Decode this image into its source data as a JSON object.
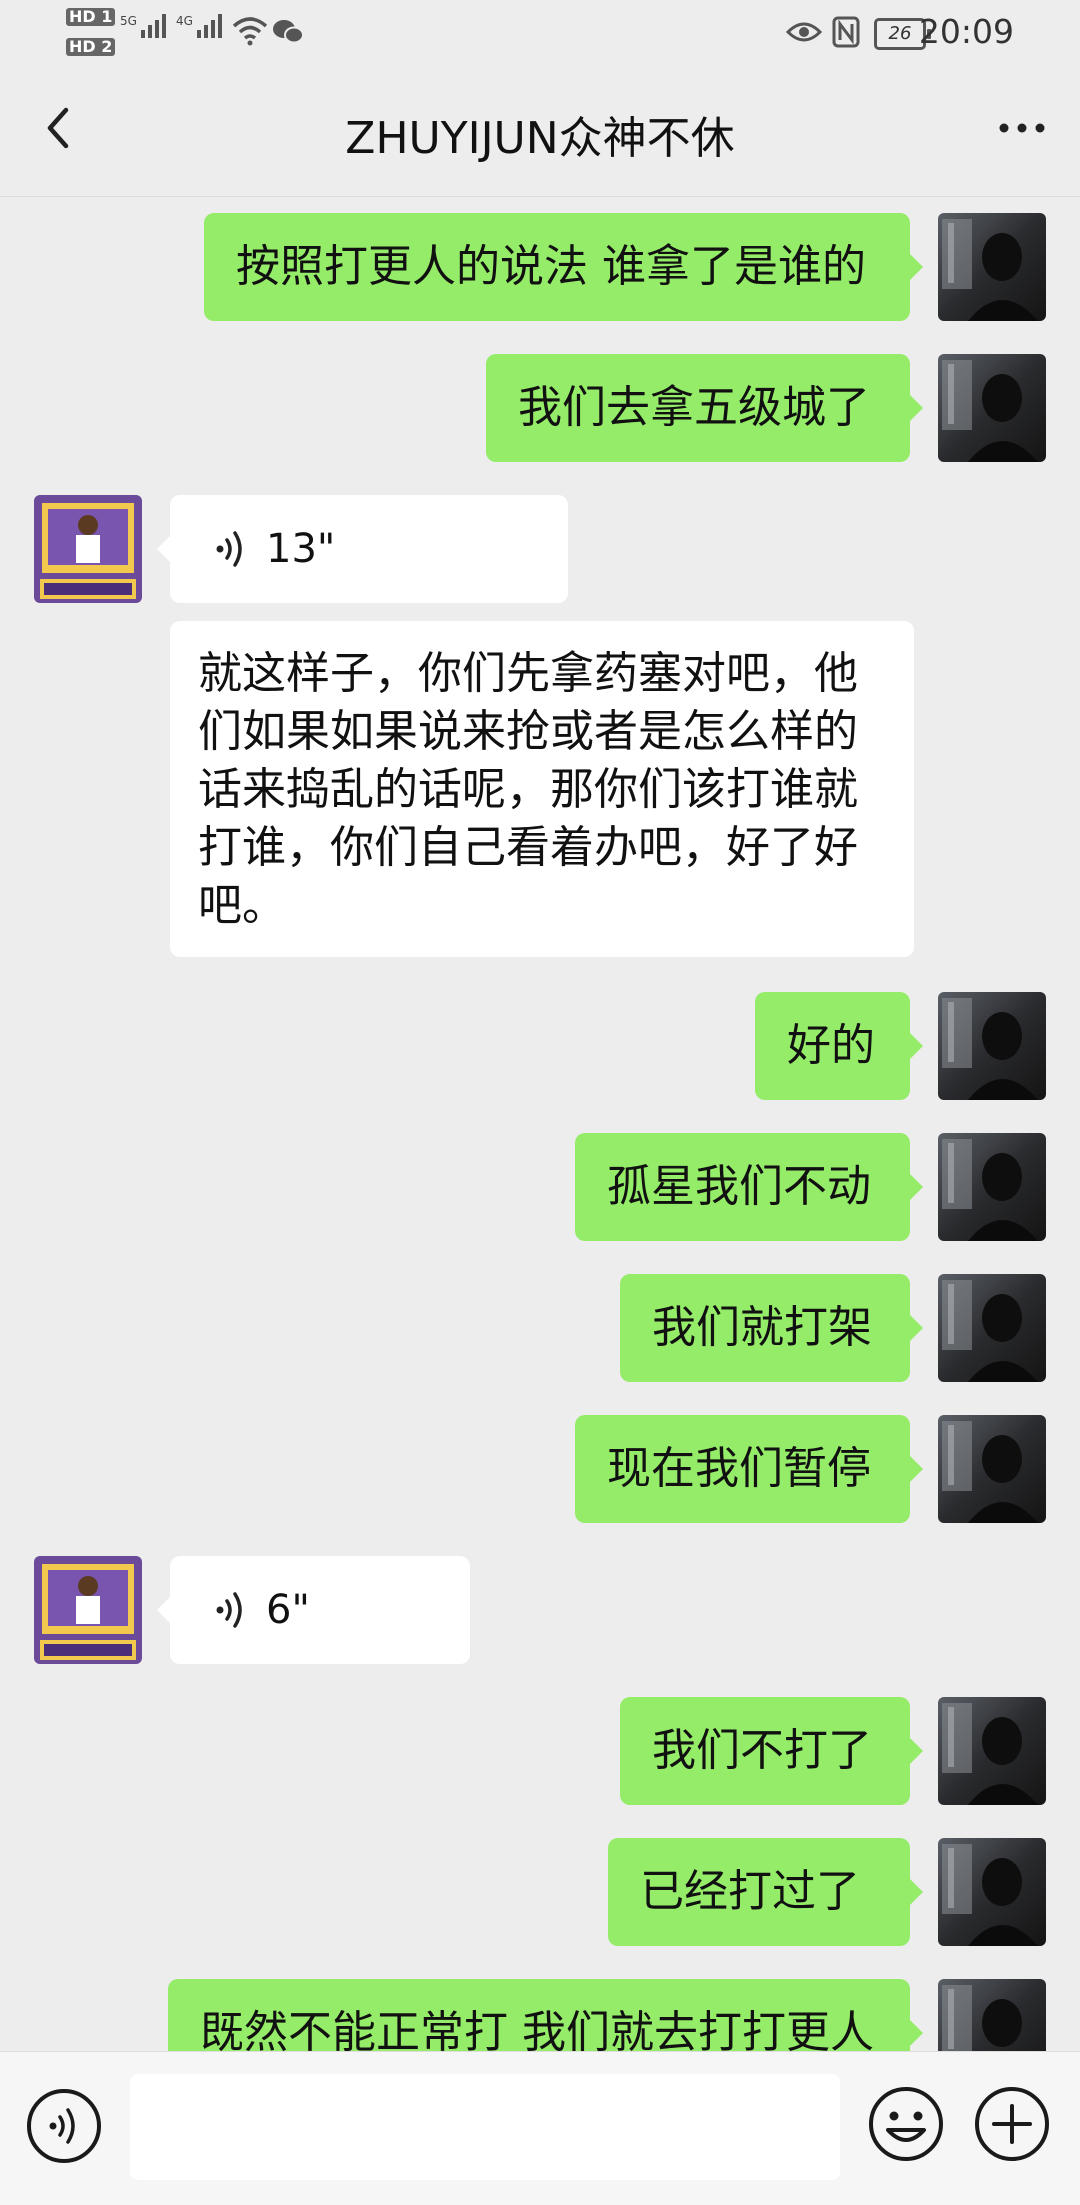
{
  "status_bar": {
    "hd1": "HD 1",
    "hd2": "HD 2",
    "net1": "5G",
    "net2": "4G",
    "battery": "26",
    "time": "20:09",
    "icons": [
      "signal-icon",
      "wifi-icon",
      "wechat-icon",
      "eye-icon",
      "nfc-icon",
      "battery-icon"
    ]
  },
  "nav": {
    "title": "ZHUYIJUN众神不休",
    "back_icon": "chevron-left-icon",
    "more_icon": "more-dots-icon"
  },
  "colors": {
    "background": "#ededed",
    "sent_bubble": "#95ec69",
    "received_bubble": "#ffffff",
    "input_bar": "#f6f6f6"
  },
  "messages": [
    {
      "sender": "me",
      "type": "text",
      "text": "按照打更人的说法 谁拿了是谁的"
    },
    {
      "sender": "me",
      "type": "text",
      "text": "我们去拿五级城了"
    },
    {
      "sender": "other",
      "type": "voice",
      "duration": "13\""
    },
    {
      "sender": "other",
      "type": "transcript",
      "text": "就这样子，你们先拿药塞对吧，他们如果如果说来抢或者是怎么样的话来捣乱的话呢，那你们该打谁就打谁，你们自己看着办吧，好了好吧。"
    },
    {
      "sender": "me",
      "type": "text",
      "text": "好的"
    },
    {
      "sender": "me",
      "type": "text",
      "text": "孤星我们不动"
    },
    {
      "sender": "me",
      "type": "text",
      "text": "我们就打架"
    },
    {
      "sender": "me",
      "type": "text",
      "text": "现在我们暂停"
    },
    {
      "sender": "other",
      "type": "voice",
      "duration": "6\""
    },
    {
      "sender": "me",
      "type": "text",
      "text": "我们不打了"
    },
    {
      "sender": "me",
      "type": "text",
      "text": "已经打过了"
    },
    {
      "sender": "me",
      "type": "text",
      "text": "既然不能正常打 我们就去打打更人"
    }
  ],
  "input_bar": {
    "voice_icon": "voice-input-icon",
    "text_value": "",
    "emoji_icon": "emoji-icon",
    "plus_icon": "plus-icon"
  }
}
